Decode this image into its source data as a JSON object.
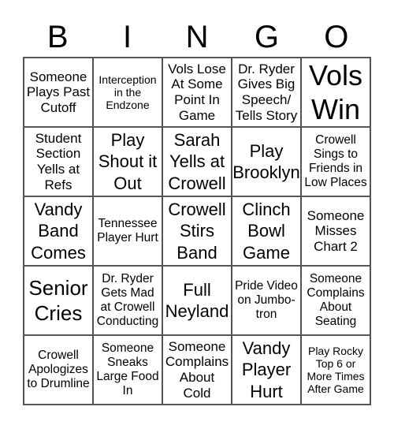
{
  "header": [
    "B",
    "I",
    "N",
    "G",
    "O"
  ],
  "cells": [
    {
      "text": "Someone Plays Past Cutoff",
      "size": "s3"
    },
    {
      "text": "Interception in the Endzone",
      "size": "s1"
    },
    {
      "text": "Vols Lose At Some Point In Game",
      "size": "s3"
    },
    {
      "text": "Dr. Ryder Gives Big Speech/ Tells Story",
      "size": "s3"
    },
    {
      "text": "Vols Win",
      "size": "s6"
    },
    {
      "text": "Student Section Yells at Refs",
      "size": "s3"
    },
    {
      "text": "Play Shout it Out",
      "size": "s4"
    },
    {
      "text": "Sarah Yells at Crowell",
      "size": "s4"
    },
    {
      "text": "Play Brooklyn",
      "size": "s4"
    },
    {
      "text": "Crowell Sings to Friends in Low Places",
      "size": "s2"
    },
    {
      "text": "Vandy Band Comes",
      "size": "s4"
    },
    {
      "text": "Tennessee Player Hurt",
      "size": "s2"
    },
    {
      "text": "Crowell Stirs Band",
      "size": "s4"
    },
    {
      "text": "Clinch Bowl Game",
      "size": "s4"
    },
    {
      "text": "Someone Misses Chart 2",
      "size": "s3"
    },
    {
      "text": "Senior Cries",
      "size": "s5"
    },
    {
      "text": "Dr. Ryder Gets Mad at Crowell Conducting",
      "size": "s2"
    },
    {
      "text": "Full Neyland",
      "size": "s4"
    },
    {
      "text": "Pride Video on Jumbo- tron",
      "size": "s2"
    },
    {
      "text": "Someone Complains About Seating",
      "size": "s2"
    },
    {
      "text": "Crowell Apologizes to Drumline",
      "size": "s2"
    },
    {
      "text": "Someone Sneaks Large Food In",
      "size": "s2"
    },
    {
      "text": "Someone Complains About Cold",
      "size": "s3"
    },
    {
      "text": "Vandy Player Hurt",
      "size": "s4"
    },
    {
      "text": "Play Rocky Top 6 or More Times After Game",
      "size": "s1"
    }
  ]
}
